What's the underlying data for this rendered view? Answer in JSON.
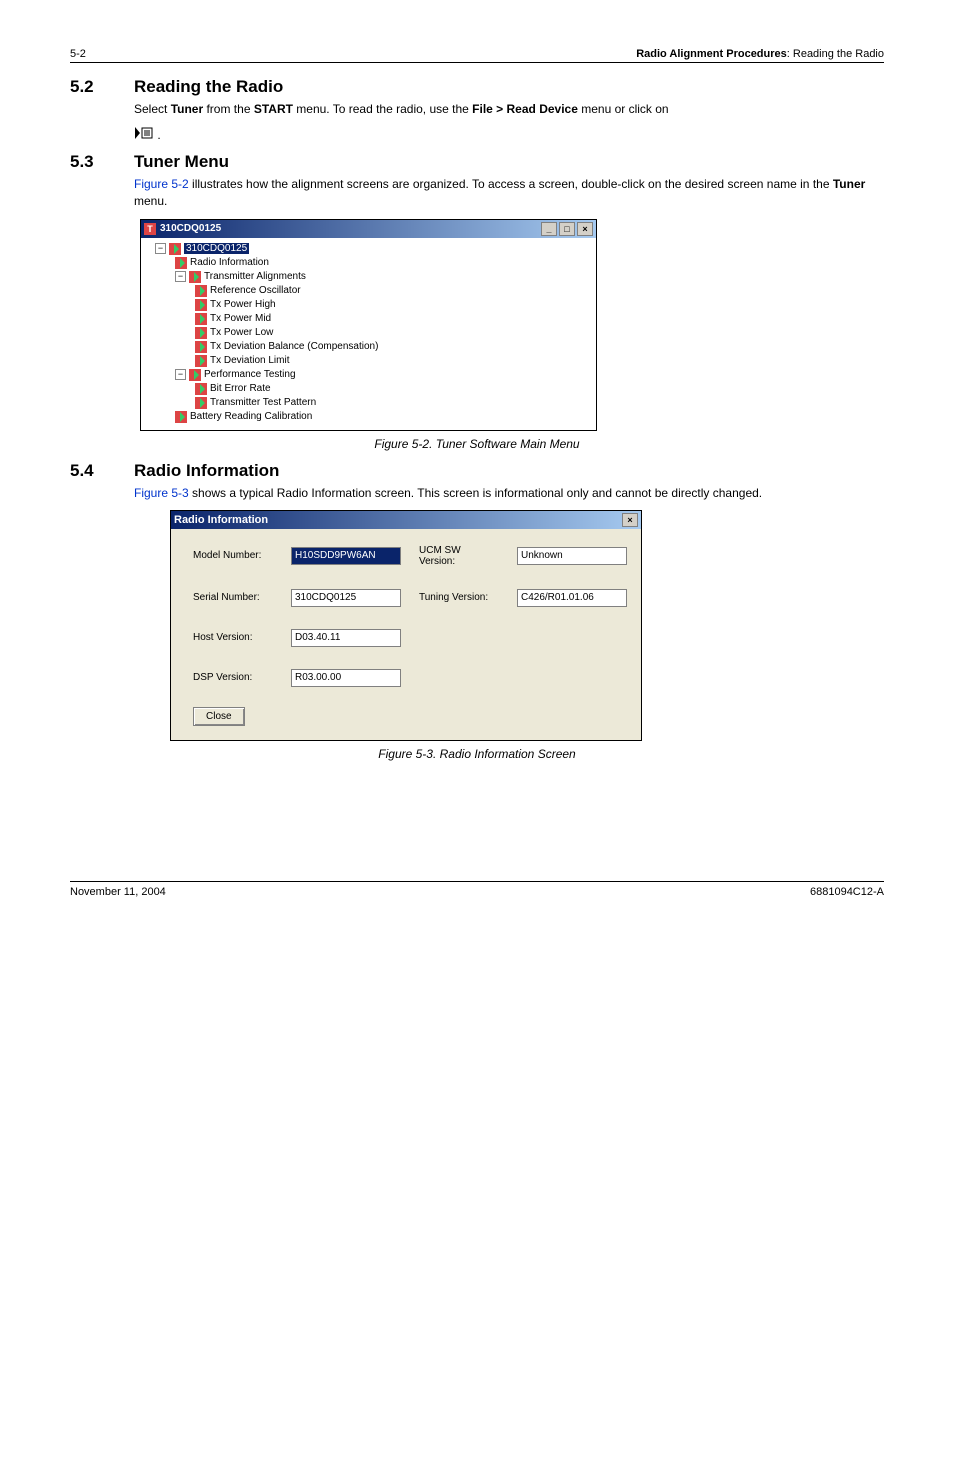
{
  "header": {
    "page_num": "5-2",
    "right_bold": "Radio Alignment Procedures",
    "right_rest": ": Reading the Radio"
  },
  "s52": {
    "num": "5.2",
    "title": "Reading the Radio",
    "p1a": "Select ",
    "p1b": "Tuner",
    "p1c": " from the ",
    "p1d": "START",
    "p1e": " menu. To read the radio, use the ",
    "p1f": "File > Read Device",
    "p1g": " menu or click on"
  },
  "s53": {
    "num": "5.3",
    "title": "Tuner Menu",
    "link": "Figure 5-2",
    "p1": " illustrates how the alignment screens are organized. To access a screen, double-click on the desired screen name in the ",
    "bold": "Tuner",
    "p2": " menu."
  },
  "tree": {
    "wintitle": "310CDQ0125",
    "root": "310CDQ0125",
    "n_radio_info": "Radio Information",
    "n_tx_align": "Transmitter Alignments",
    "n_ref_osc": "Reference Oscillator",
    "n_tx_high": "Tx Power High",
    "n_tx_mid": "Tx Power Mid",
    "n_tx_low": "Tx Power Low",
    "n_tx_dev_bal": "Tx Deviation Balance (Compensation)",
    "n_tx_dev_lim": "Tx Deviation Limit",
    "n_perf": "Performance Testing",
    "n_ber": "Bit Error Rate",
    "n_tx_test": "Transmitter Test Pattern",
    "n_batt": "Battery Reading Calibration"
  },
  "fig52": "Figure 5-2.  Tuner Software Main Menu",
  "s54": {
    "num": "5.4",
    "title": "Radio Information",
    "link": "Figure 5-3",
    "p1": " shows a typical Radio Information screen. This screen is informational only and cannot be directly changed."
  },
  "dlg": {
    "title": "Radio Information",
    "l_model": "Model Number:",
    "v_model": "H10SDD9PW6AN",
    "l_ucm": "UCM SW Version:",
    "v_ucm": "Unknown",
    "l_serial": "Serial Number:",
    "v_serial": "310CDQ0125",
    "l_tuning": "Tuning Version:",
    "v_tuning": "C426/R01.01.06",
    "l_host": "Host Version:",
    "v_host": "D03.40.11",
    "l_dsp": "DSP Version:",
    "v_dsp": "R03.00.00",
    "btn_close": "Close"
  },
  "fig53": "Figure 5-3.  Radio Information Screen",
  "footer": {
    "left": "November 11, 2004",
    "right": "6881094C12-A"
  }
}
